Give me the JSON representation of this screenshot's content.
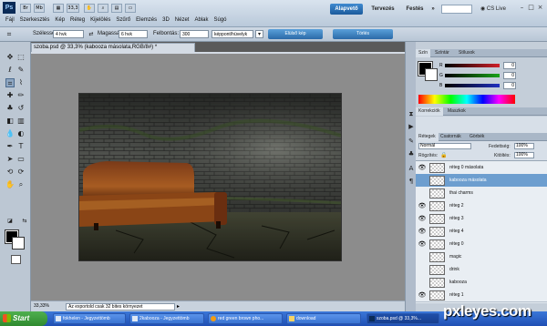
{
  "app": {
    "logo_text": "Ps",
    "menu": [
      "Fájl",
      "Szerkesztés",
      "Kép",
      "Réteg",
      "Kijelölés",
      "Szűrő",
      "Elemzés",
      "3D",
      "Nézet",
      "Ablak",
      "Súgó"
    ],
    "zoom_indicator": "33,3",
    "workspaces": [
      "Alapvető",
      "Tervezés",
      "Festés"
    ],
    "workspace_more": "»",
    "cs_live": "CS Live",
    "window_controls": [
      "–",
      "□",
      "×"
    ]
  },
  "options_bar": {
    "width_label": "Szélesség:",
    "width_value": "4 hvk",
    "height_label": "Magasság:",
    "height_value": "6 hvk",
    "resolution_label": "Felbontás:",
    "resolution_value": "300",
    "unit_value": "képpont/hüvelyk",
    "front_image_button": "Elülső kép",
    "clear_button": "Törlés"
  },
  "document": {
    "tab_title": "szoba.psd @ 33,3% (kabooza másolata,RGB/8#) *",
    "zoom": "33,33%",
    "status_message": "Az exportold csak 32 bites környezet"
  },
  "color_panel": {
    "tabs": [
      "Szín",
      "Színtár",
      "Stílusok"
    ],
    "channels": [
      {
        "label": "R",
        "value": "0",
        "color": "#d0202a"
      },
      {
        "label": "G",
        "value": "0",
        "color": "#1aa31a"
      },
      {
        "label": "B",
        "value": "0",
        "color": "#2030c0"
      }
    ]
  },
  "adjust_panel": {
    "tabs": [
      "Korrekciók",
      "Maszkok"
    ]
  },
  "layers_panel": {
    "tabs": [
      "Rétegek",
      "Csatornák",
      "Görbék"
    ],
    "blend_mode": "Normál",
    "opacity_label": "Fedettség:",
    "opacity_value": "100%",
    "lock_label": "Rögzítés:",
    "fill_label": "Kitöltés:",
    "fill_value": "100%",
    "layers": [
      {
        "name": "réteg 0 másolata",
        "visible": true,
        "active": false
      },
      {
        "name": "kabooza másolata",
        "visible": false,
        "active": true
      },
      {
        "name": "thai charms",
        "visible": false,
        "active": false
      },
      {
        "name": "réteg 2",
        "visible": true,
        "active": false
      },
      {
        "name": "réteg 3",
        "visible": true,
        "active": false
      },
      {
        "name": "réteg 4",
        "visible": true,
        "active": false
      },
      {
        "name": "réteg 0",
        "visible": true,
        "active": false
      },
      {
        "name": "magic",
        "visible": false,
        "active": false
      },
      {
        "name": "drink",
        "visible": false,
        "active": false
      },
      {
        "name": "kabooza",
        "visible": false,
        "active": false
      },
      {
        "name": "réteg 1",
        "visible": true,
        "active": false
      }
    ]
  },
  "taskbar": {
    "start_label": "Start",
    "tasks": [
      "fokhelen - Jegyzettömb",
      "2kabooza - Jegyzettömb",
      "red green brown pho...",
      "download",
      "szoba.psd @ 33,3%..."
    ],
    "watermark": "pxleyes.com"
  }
}
